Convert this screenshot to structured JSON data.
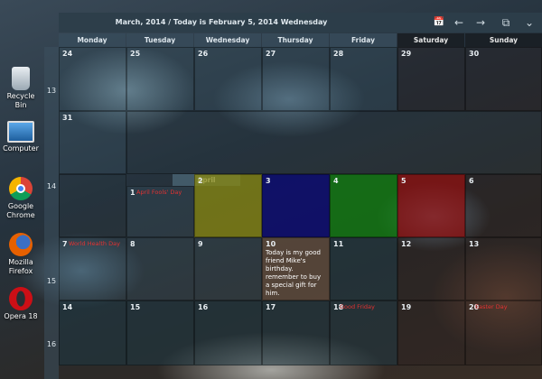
{
  "desktop": {
    "icons": [
      {
        "label": "Recycle Bin",
        "icon": "recycle-bin-icon"
      },
      {
        "label": "Computer",
        "icon": "computer-icon"
      },
      {
        "label": "Google Chrome",
        "icon": "chrome-icon"
      },
      {
        "label": "Mozilla Firefox",
        "icon": "firefox-icon"
      },
      {
        "label": "Opera 18",
        "icon": "opera-icon"
      }
    ]
  },
  "calendar": {
    "title": "March, 2014 / Today is February 5, 2014 Wednesday",
    "buttons": {
      "calendar": "📅",
      "prev": "←",
      "next": "→",
      "windows": "⧉",
      "collapse": "⌄"
    },
    "day_names": [
      "Monday",
      "Tuesday",
      "Wednesday",
      "Thursday",
      "Friday",
      "Saturday",
      "Sunday"
    ],
    "week_numbers": [
      "13",
      "14",
      "15",
      "16"
    ],
    "month_tag": "April",
    "weeks": [
      [
        "24",
        "25",
        "26",
        "27",
        "28",
        "29",
        "30"
      ],
      [
        "31",
        "",
        "",
        "",
        "",
        "",
        ""
      ],
      [
        "",
        "1",
        "2",
        "3",
        "4",
        "5",
        "6"
      ],
      [
        "7",
        "8",
        "9",
        "10",
        "11",
        "12",
        "13"
      ],
      [
        "14",
        "15",
        "16",
        "17",
        "18",
        "19",
        "20"
      ]
    ],
    "events": {
      "apr1": "April Fools' Day",
      "apr7": "World Health Day",
      "apr18": "Good Friday",
      "apr20": "Easter Day"
    },
    "note_apr10": "Today is my good friend Mike's birthday. remember to buy a special gift for him.",
    "cell_colors": {
      "apr2": "#8a8a10",
      "apr3": "#0c0c70",
      "apr4": "#107a10",
      "apr5": "#8a1010"
    }
  }
}
